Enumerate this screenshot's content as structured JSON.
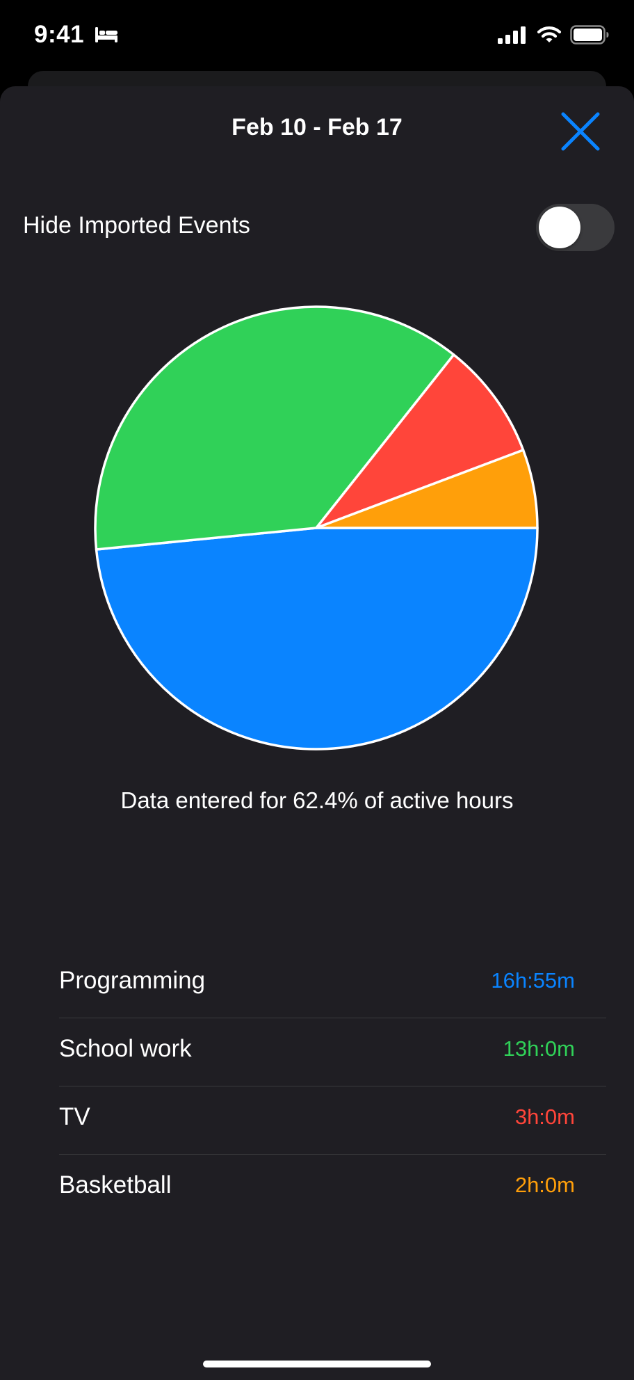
{
  "status_bar": {
    "time": "9:41",
    "icons": [
      "bed-icon",
      "cellular-signal-icon",
      "wifi-icon",
      "battery-icon"
    ]
  },
  "sheet": {
    "title": "Feb 10 - Feb 17",
    "close_icon": "close-x-icon",
    "accent_color": "#0a84ff"
  },
  "toggle": {
    "label": "Hide Imported Events",
    "state": "off"
  },
  "chart_data": {
    "type": "pie",
    "slices": [
      {
        "label": "Programming",
        "value": 16.9167,
        "color": "#0a84ff"
      },
      {
        "label": "School work",
        "value": 13.0,
        "color": "#30d158"
      },
      {
        "label": "TV",
        "value": 3.0,
        "color": "#ff453a"
      },
      {
        "label": "Basketball",
        "value": 2.0,
        "color": "#ff9f0a"
      }
    ]
  },
  "coverage_text": "Data entered for 62.4% of active hours",
  "items": [
    {
      "name": "Programming",
      "time": "16h:55m",
      "color": "#0a84ff"
    },
    {
      "name": "School work",
      "time": "13h:0m",
      "color": "#30d158"
    },
    {
      "name": "TV",
      "time": "3h:0m",
      "color": "#ff453a"
    },
    {
      "name": "Basketball",
      "time": "2h:0m",
      "color": "#ff9f0a"
    }
  ]
}
